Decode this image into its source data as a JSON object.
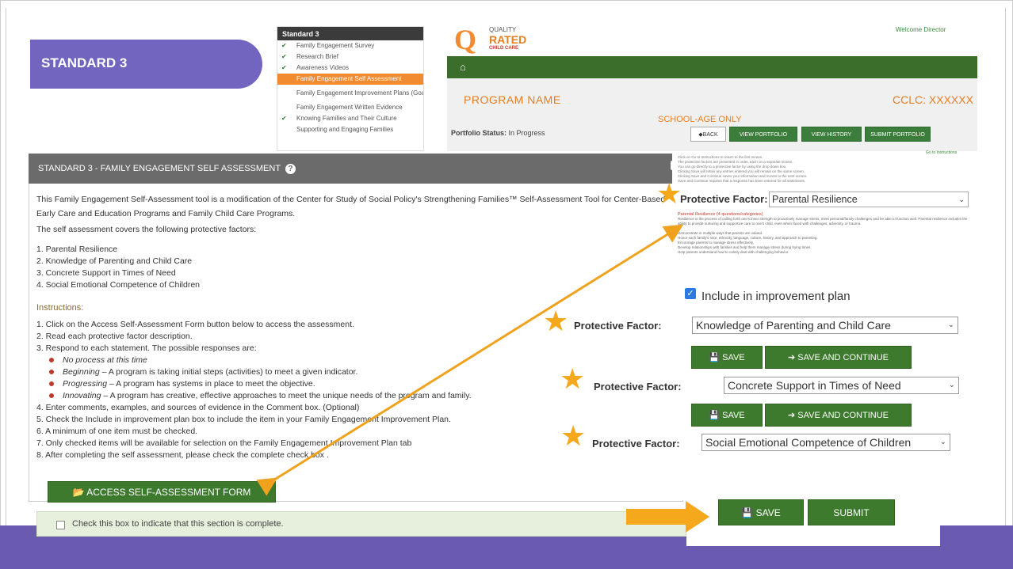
{
  "slide": {
    "title": "STANDARD 3"
  },
  "menu": {
    "header": "Standard 3",
    "items": [
      {
        "label": "Family Engagement Survey",
        "checked": true,
        "active": false
      },
      {
        "label": "Research Brief",
        "checked": true,
        "active": false
      },
      {
        "label": "Awareness Videos",
        "checked": true,
        "active": false
      },
      {
        "label": "Family Engagement Self Assessment",
        "checked": false,
        "active": true
      },
      {
        "label": "Family Engagement Improvement Plans (Goals)",
        "checked": false,
        "active": false
      },
      {
        "label": "Family Engagement Written Evidence",
        "checked": false,
        "active": false
      },
      {
        "label": "Knowing Families and Their Culture",
        "checked": true,
        "active": false
      },
      {
        "label": "Supporting and Engaging Families",
        "checked": false,
        "active": false
      }
    ]
  },
  "logo": {
    "line1": "QUALITY",
    "line2": "RATED",
    "line3": "CHILD CARE"
  },
  "header": {
    "welcome": "Welcome Director",
    "program_name": "PROGRAM NAME",
    "cclc": "CCLC: XXXXXX",
    "school_age": "SCHOOL-AGE ONLY",
    "portfolio_label": "Portfolio Status:",
    "portfolio_value": "In Progress",
    "buttons": {
      "back": "◆BACK",
      "view_portfolio": "VIEW PORTFOLIO",
      "view_history": "VIEW HISTORY",
      "submit_portfolio": "SUBMIT PORTFOLIO"
    }
  },
  "panel": {
    "title": "STANDARD 3 - FAMILY ENGAGEMENT SELF ASSESSMENT",
    "intro": "This Family Engagement Self-Assessment tool is a modification of the Center for Study of Social Policy's Strengthening Families™ Self-Assessment Tool for Center-Based Early Care and Education Programs and Family Child Care Programs.",
    "covers": "The self assessment covers the following protective factors:",
    "factors": [
      "1. Parental Resilience",
      "2. Knowledge of Parenting and Child Care",
      "3. Concrete Support in Times of Need",
      "4. Social Emotional Competence of Children"
    ],
    "instructions_heading": "Instructions:",
    "steps": [
      "1. Click on the Access Self-Assessment Form button below to access the assessment.",
      "2. Read each protective factor description.",
      "3. Respond to each statement. The possible responses are:"
    ],
    "responses": [
      {
        "term": "No process at this time",
        "desc": ""
      },
      {
        "term": "Beginning",
        "desc": " – A program is taking initial steps (activities) to meet a given indicator."
      },
      {
        "term": "Progressing",
        "desc": " – A program has systems in place to meet the objective."
      },
      {
        "term": "Innovating",
        "desc": " – A program has creative, effective approaches to meet the unique needs of the program and family."
      }
    ],
    "steps2": [
      "4. Enter comments, examples, and sources of evidence in the Comment box. (Optional)",
      "5. Check the Include in improvement plan box to include the item in your Family Engagement Improvement Plan.",
      "6. A minimum of one item must be checked.",
      "7. Only checked items will be available for selection on the Family Engagement Improvement Plan tab",
      "8. After completing the self assessment, please check the complete check box ."
    ],
    "access_button": "ACCESS SELF-ASSESSMENT FORM",
    "complete_label": "Check this box to indicate that this section is complete."
  },
  "form": {
    "tiny_lines": [
      "Click on Go to Instructions to return to the first screen.",
      "The protective factors are presented in order, each on a separate screen.",
      "You can go directly to a protective factor by using the drop down box.",
      "Clicking Save will retain any entries entered you will remain on the same screen.",
      "Clicking Save and Continue saves your information and moves to the next screen.",
      "Save and Continue requires that a response has been entered for all statements."
    ],
    "go_to_instructions": "Go to Instructions",
    "pf_label": "Protective Factor:",
    "pf1_value": "Parental Resilience",
    "pf1_heading": "Parental Resilience (4 questions/categories)",
    "pf1_desc": "Resilience is the process of calling forth one's inner strength to proactively manage stress, meet personal/family challenges and be able to function well. Parental resilience includes the ability to provide nurturing and supportive care to one's child, even when faced with challenges, adversity, or trauma.",
    "pf1_items": [
      "Demonstrate in multiple ways that parents are valued.",
      "Honor each family's race, ethnicity, language, culture, history, and approach to parenting.",
      "Encourage parents to manage stress effectively.",
      "Develop relationships with families and help them manage stress during trying times.",
      "Help parents understand how to calmly deal with challenging behavior."
    ],
    "include_label": "Include in improvement plan",
    "pf2_value": "Knowledge of Parenting and Child Care",
    "pf3_value": "Concrete Support in Times of Need",
    "pf4_value": "Social Emotional Competence of Children",
    "save": "SAVE",
    "save_continue": "SAVE AND CONTINUE",
    "submit": "SUBMIT"
  },
  "colors": {
    "brand_purple": "#7265c0",
    "green": "#3d7a2e",
    "orange": "#f28a30",
    "star": "#f5a81b"
  }
}
